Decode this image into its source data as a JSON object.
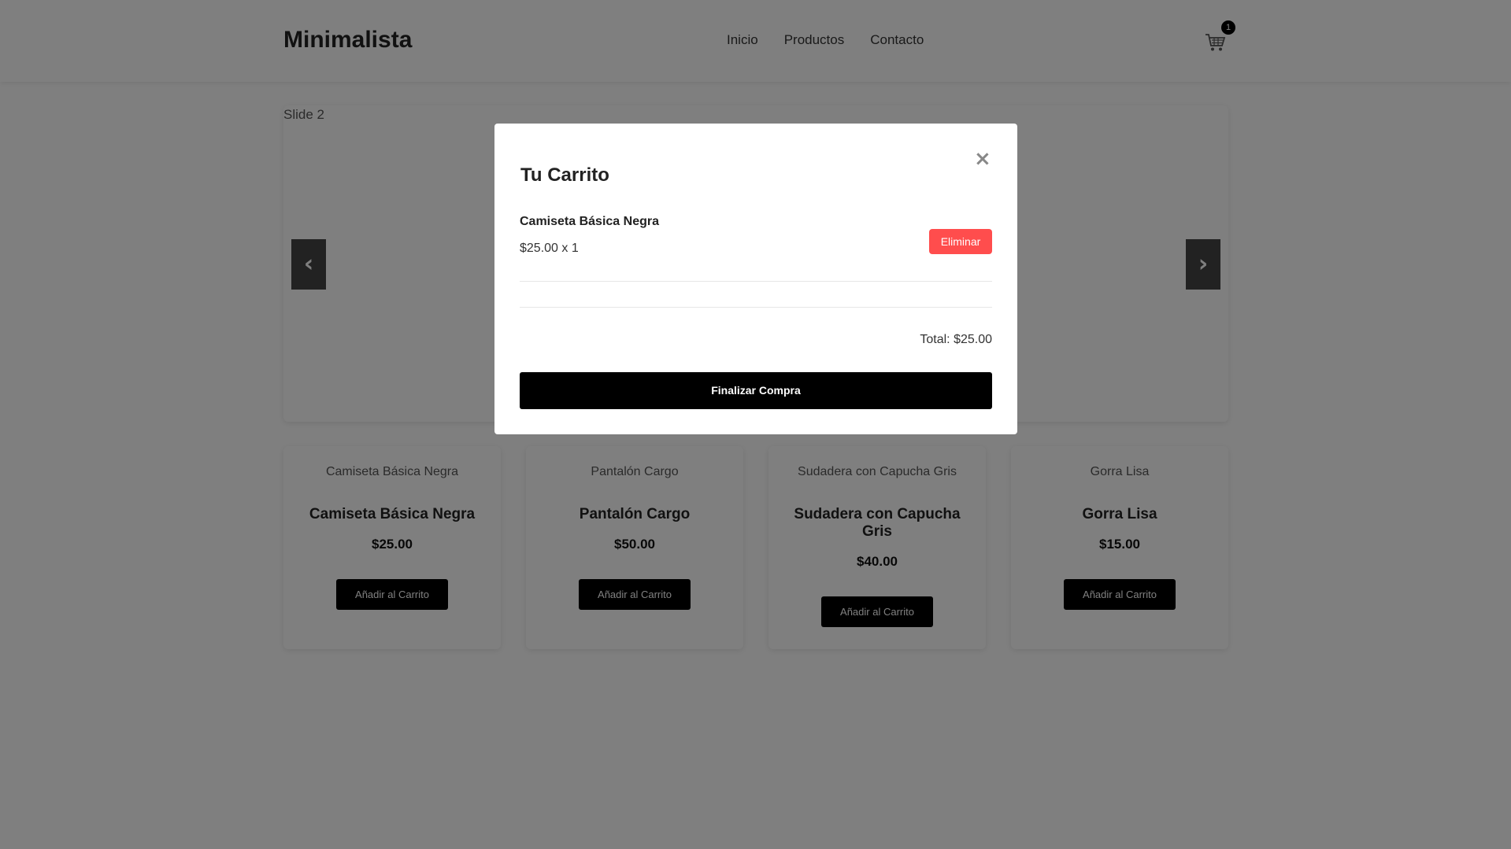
{
  "header": {
    "logo": "Minimalista",
    "nav": [
      "Inicio",
      "Productos",
      "Contacto"
    ],
    "cart_icon": "shopping-cart-icon",
    "cart_count": "1"
  },
  "carousel": {
    "slide_alt": "Slide 2",
    "prev_label": "‹",
    "next_label": "›"
  },
  "products": [
    {
      "image_alt": "Camiseta Básica Negra",
      "name": "Camiseta Básica Negra",
      "price": "$25.00",
      "button": "Añadir al Carrito"
    },
    {
      "image_alt": "Pantalón Cargo",
      "name": "Pantalón Cargo",
      "price": "$50.00",
      "button": "Añadir al Carrito"
    },
    {
      "image_alt": "Sudadera con Capucha Gris",
      "name": "Sudadera con Capucha Gris",
      "price": "$40.00",
      "button": "Añadir al Carrito"
    },
    {
      "image_alt": "Gorra Lisa",
      "name": "Gorra Lisa",
      "price": "$15.00",
      "button": "Añadir al Carrito"
    }
  ],
  "modal": {
    "title": "Tu Carrito",
    "close": "×",
    "items": [
      {
        "name": "Camiseta Básica Negra",
        "qty_line": "$25.00 x 1",
        "remove": "Eliminar"
      }
    ],
    "total": "Total: $25.00",
    "checkout": "Finalizar Compra"
  },
  "colors": {
    "overlay": "#000000",
    "remove_button": "#ff4d4d",
    "primary_button": "#000000"
  }
}
